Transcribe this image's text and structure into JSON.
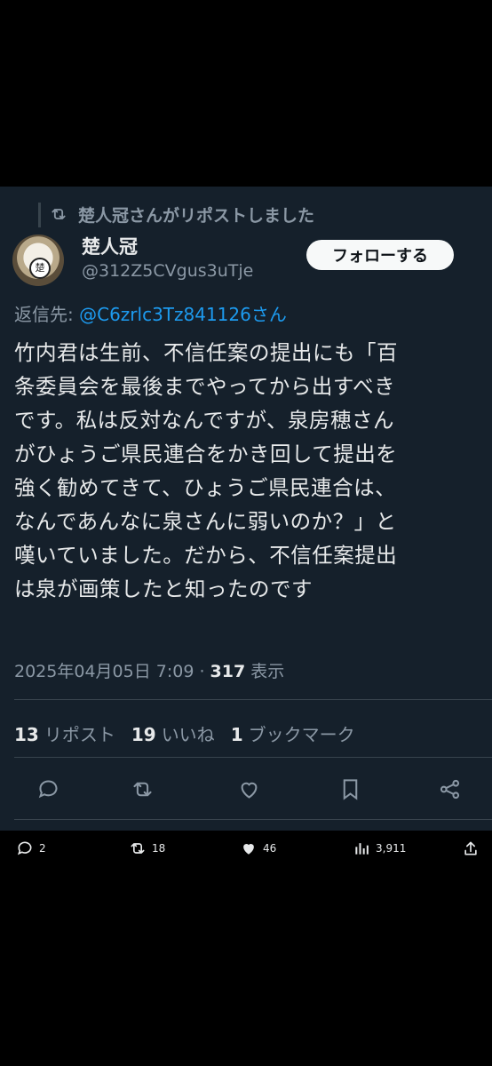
{
  "repost_banner": {
    "text": "楚人冠さんがリポストしました",
    "icon": "repost-icon"
  },
  "author": {
    "name": "楚人冠",
    "handle": "@312Z5CVgus3uTje",
    "avatar_glyph": "楚"
  },
  "follow_button": {
    "label": "フォローする"
  },
  "reply_to": {
    "prefix": "返信先: ",
    "mention": "@C6zrlc3Tz841126さん"
  },
  "tweet_lines": [
    "竹内君は生前、不信任案の提出にも「百",
    "条委員会を最後までやってから出すべき",
    "です。私は反対なんですが、泉房穂さん",
    "がひょうご県民連合をかき回して提出を",
    "強く勧めてきて、ひょうご県民連合は、",
    "なんであんなに泉さんに弱いのか？」と",
    "嘆いていました。だから、不信任案提出",
    "は泉が画策したと知ったのです"
  ],
  "meta": {
    "datetime": "2025年04月05日 7:09 · ",
    "views_count": "317",
    "views_label": " 表示"
  },
  "stats": {
    "reposts_count": "13",
    "reposts_label": "リポスト",
    "likes_count": "19",
    "likes_label": "いいね",
    "bookmarks_count": "1",
    "bookmarks_label": "ブックマーク"
  },
  "actions": [
    "reply-icon",
    "repost-icon",
    "like-icon",
    "bookmark-icon",
    "share-icon"
  ],
  "bottom_bar": {
    "replies": "2",
    "reposts": "18",
    "likes": "46",
    "views": "3,911"
  },
  "colors": {
    "card_bg": "#15202b",
    "accent": "#1d9bf0",
    "muted": "#8b98a5",
    "text": "#e7e9ea"
  }
}
